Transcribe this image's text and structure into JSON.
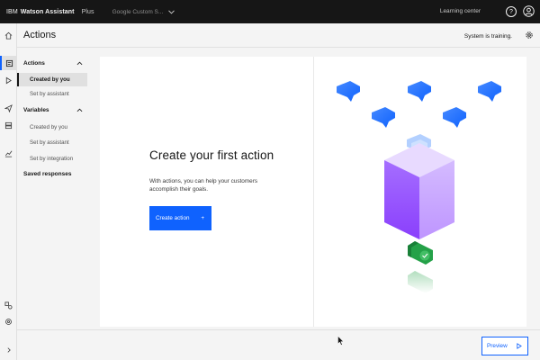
{
  "header": {
    "brand_ibm": "IBM",
    "brand_product": "Watson Assistant",
    "brand_plan": "Plus",
    "instance_name": "Google Custom S...",
    "learning_center": "Learning center",
    "help_label": "?"
  },
  "page": {
    "title": "Actions",
    "status": "System is training."
  },
  "subnav": {
    "actions_heading": "Actions",
    "actions_items": [
      {
        "label": "Created by you",
        "active": true
      },
      {
        "label": "Set by assistant",
        "active": false
      }
    ],
    "variables_heading": "Variables",
    "variables_items": [
      {
        "label": "Created by you"
      },
      {
        "label": "Set by assistant"
      },
      {
        "label": "Set by integration"
      }
    ],
    "saved_responses": "Saved responses"
  },
  "empty_state": {
    "heading": "Create your first action",
    "description": "With actions, you can help your customers accomplish their goals.",
    "button_label": "Create action",
    "button_icon": "+"
  },
  "footer": {
    "preview_label": "Preview",
    "preview_icon": "play-icon"
  },
  "icons": {
    "rail": [
      "home-icon",
      "actions-icon",
      "play-icon",
      "send-icon",
      "database-icon",
      "analytics-icon",
      "integrations-icon",
      "settings-icon",
      "expand-icon"
    ]
  },
  "colors": {
    "primary": "#0f62fe",
    "header_bg": "#161616",
    "cube_purple": "#8a3ffc",
    "bubble_blue": "#0f62fe",
    "check_green": "#24a148"
  }
}
